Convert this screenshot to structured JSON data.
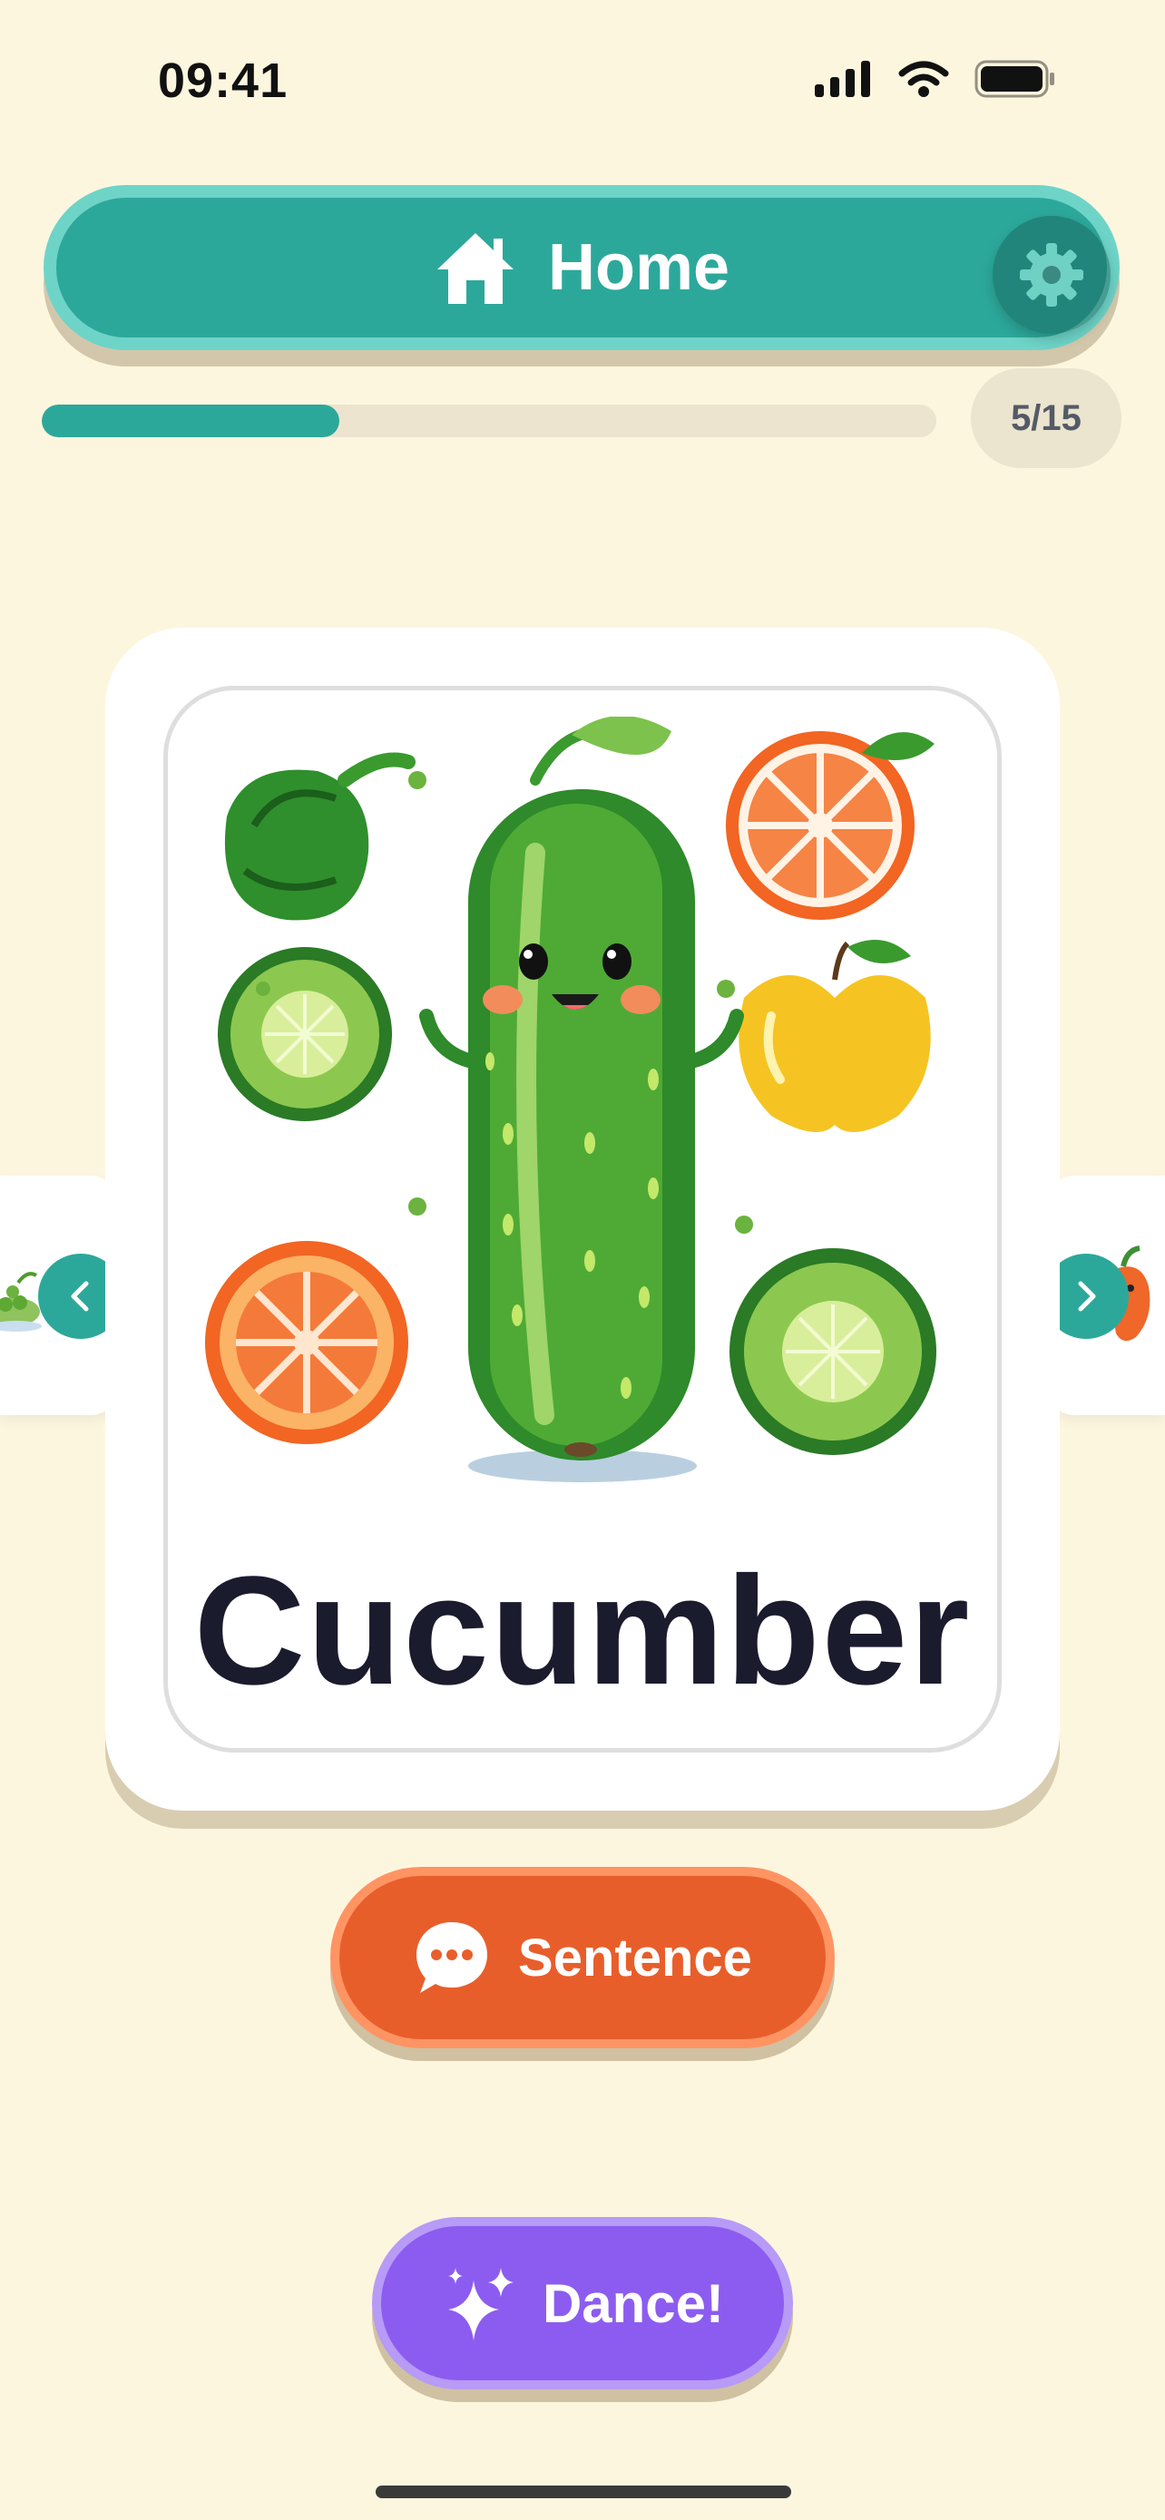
{
  "status_bar": {
    "time": "09:41"
  },
  "header": {
    "home_label": "Home",
    "home_icon": "house-icon",
    "settings_icon": "gear-icon"
  },
  "progress": {
    "current": 5,
    "total": 15,
    "label": "5/15",
    "fill_fraction": 0.333
  },
  "card": {
    "word": "Cucumber",
    "illustration": "cartoon cucumber with vegetable and fruit slices",
    "prev_icon": "chevron-left-icon",
    "next_icon": "chevron-right-icon"
  },
  "actions": {
    "sentence_label": "Sentence",
    "sentence_icon": "speech-bubble-icon",
    "dance_label": "Dance!",
    "dance_icon": "sparkles-icon"
  },
  "colors": {
    "background": "#fdf6df",
    "teal": "#2ca89b",
    "orange": "#e85e2b",
    "purple": "#8c5cf0",
    "word_text": "#1b1b2e"
  }
}
